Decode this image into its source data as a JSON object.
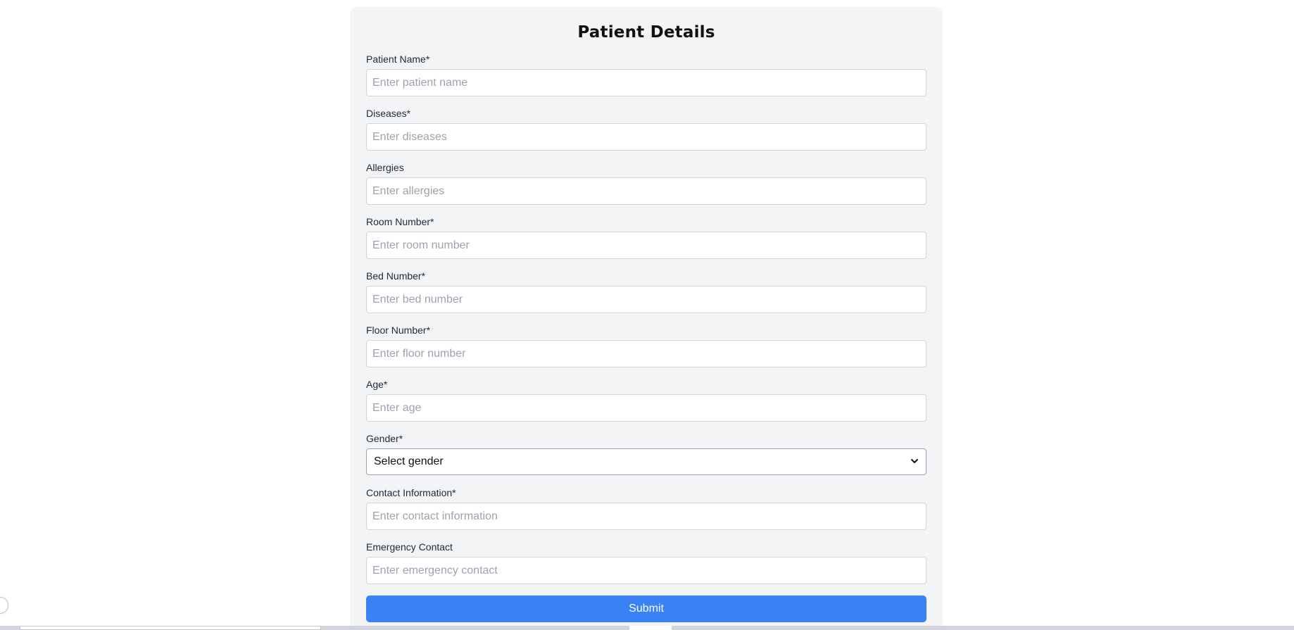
{
  "form": {
    "title": "Patient Details",
    "fields": [
      {
        "label": "Patient Name*",
        "placeholder": "Enter patient name"
      },
      {
        "label": "Diseases*",
        "placeholder": "Enter diseases"
      },
      {
        "label": "Allergies",
        "placeholder": "Enter allergies"
      },
      {
        "label": "Room Number*",
        "placeholder": "Enter room number"
      },
      {
        "label": "Bed Number*",
        "placeholder": "Enter bed number"
      },
      {
        "label": "Floor Number*",
        "placeholder": "Enter floor number"
      },
      {
        "label": "Age*",
        "placeholder": "Enter age"
      }
    ],
    "gender": {
      "label": "Gender*",
      "selected": "Select gender"
    },
    "contact": {
      "label": "Contact Information*",
      "placeholder": "Enter contact information"
    },
    "emergency": {
      "label": "Emergency Contact",
      "placeholder": "Enter emergency contact"
    },
    "submit_label": "Submit"
  },
  "colors": {
    "card_bg": "#f3f4f6",
    "accent": "#3b82f6"
  }
}
